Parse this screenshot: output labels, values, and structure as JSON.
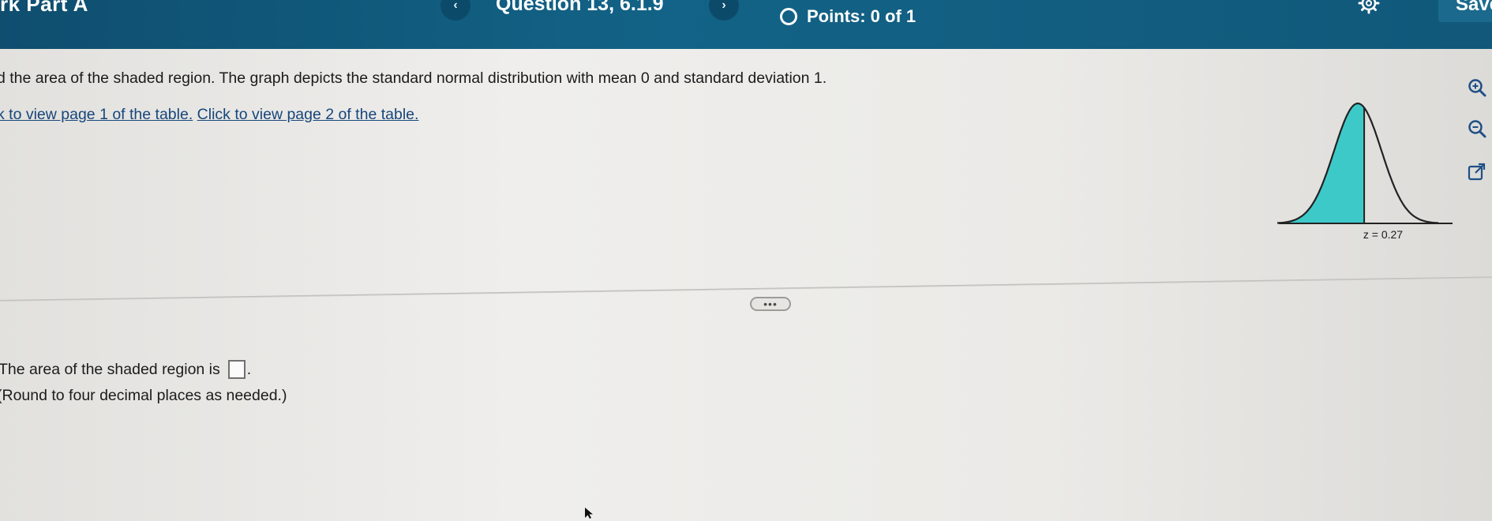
{
  "header": {
    "assignment_title": "rk Part A",
    "prev_label": "‹",
    "question_title": "Question 13, 6.1.9",
    "next_label": "›",
    "points_text": "Points: 0 of 1",
    "save_label": "Save"
  },
  "question": {
    "prompt": "d the area of the shaded region. The graph depicts the standard normal distribution with mean 0 and standard deviation 1.",
    "table_link_1": "k to view page 1 of the table.",
    "table_link_2": "Click to view page 2 of the table.",
    "graph": {
      "z_label": "z = 0.27",
      "fill_color": "#3ec9c9",
      "curve_color": "#222222",
      "shaded_side": "left",
      "z_value": 0.27
    }
  },
  "toolbar_icons": [
    "zoom-in-icon",
    "zoom-out-icon",
    "pop-out-icon"
  ],
  "more_label": "•••",
  "answer": {
    "label": "The area of the shaded region is",
    "value": "",
    "suffix": ".",
    "note": "(Round to four decimal places as needed.)"
  },
  "colors": {
    "header_bg": "#11587a",
    "link": "#17467b",
    "shaded": "#3ec9c9"
  }
}
